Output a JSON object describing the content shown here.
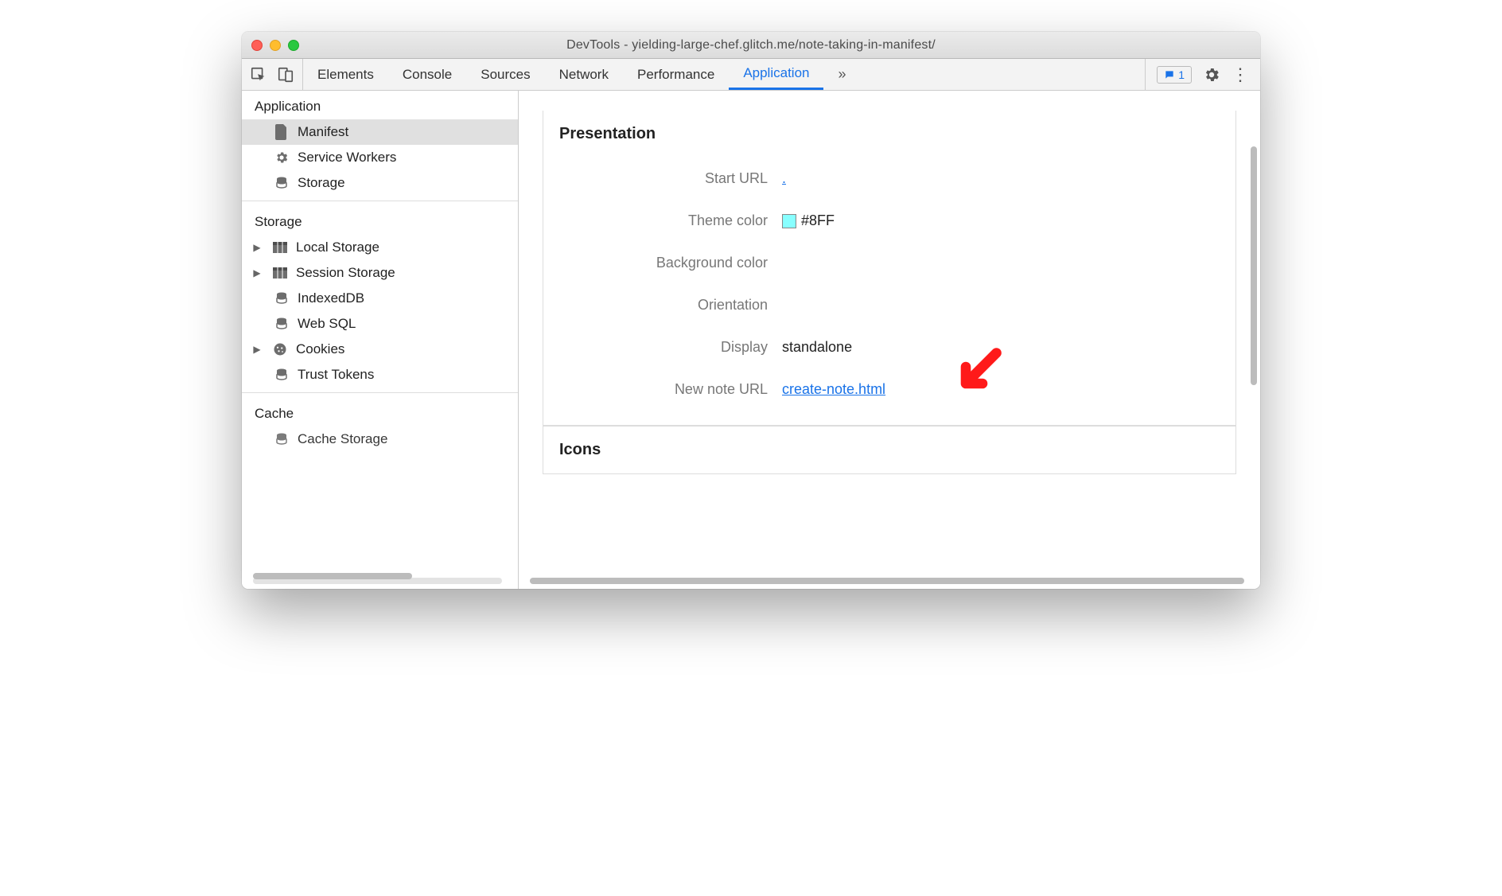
{
  "window": {
    "title": "DevTools - yielding-large-chef.glitch.me/note-taking-in-manifest/"
  },
  "tabs": {
    "items": [
      "Elements",
      "Console",
      "Sources",
      "Network",
      "Performance",
      "Application"
    ],
    "active": "Application"
  },
  "badge": {
    "count": "1"
  },
  "sidebar": {
    "groups": [
      {
        "title": "Application",
        "items": [
          {
            "icon": "file-icon",
            "label": "Manifest",
            "selected": true
          },
          {
            "icon": "gear-icon",
            "label": "Service Workers"
          },
          {
            "icon": "database-icon",
            "label": "Storage"
          }
        ]
      },
      {
        "title": "Storage",
        "items": [
          {
            "icon": "table-icon",
            "label": "Local Storage",
            "expandable": true
          },
          {
            "icon": "table-icon",
            "label": "Session Storage",
            "expandable": true
          },
          {
            "icon": "database-icon",
            "label": "IndexedDB"
          },
          {
            "icon": "database-icon",
            "label": "Web SQL"
          },
          {
            "icon": "cookie-icon",
            "label": "Cookies",
            "expandable": true
          },
          {
            "icon": "database-icon",
            "label": "Trust Tokens"
          }
        ]
      },
      {
        "title": "Cache",
        "items": [
          {
            "icon": "database-icon",
            "label": "Cache Storage"
          }
        ]
      }
    ]
  },
  "panel": {
    "section_title": "Presentation",
    "rows": {
      "start_url_label": "Start URL",
      "start_url_value": ".",
      "theme_color_label": "Theme color",
      "theme_color_value": "#8FF",
      "theme_color_swatch": "#88ffff",
      "bg_color_label": "Background color",
      "bg_color_value": "",
      "orientation_label": "Orientation",
      "orientation_value": "",
      "display_label": "Display",
      "display_value": "standalone",
      "newnote_label": "New note URL",
      "newnote_value": "create-note.html"
    },
    "icons_title": "Icons"
  }
}
